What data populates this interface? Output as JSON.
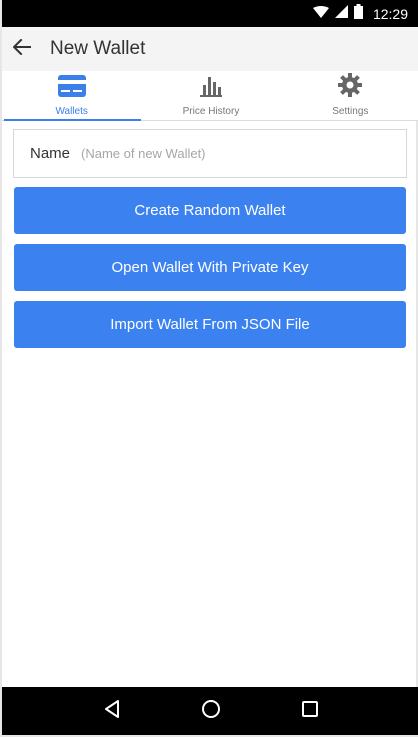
{
  "status_bar": {
    "time": "12:29",
    "icons": [
      "wifi-icon",
      "signal-icon",
      "battery-icon"
    ]
  },
  "app_bar": {
    "title": "New Wallet",
    "back_icon": "arrow-left-icon"
  },
  "tabs": [
    {
      "label": "Wallets",
      "icon": "credit-card-icon",
      "active": true
    },
    {
      "label": "Price History",
      "icon": "bar-chart-icon",
      "active": false
    },
    {
      "label": "Settings",
      "icon": "gear-icon",
      "active": false
    }
  ],
  "form": {
    "name_label": "Name",
    "name_placeholder": "(Name of new Wallet)",
    "name_value": ""
  },
  "buttons": {
    "create_random": "Create Random Wallet",
    "open_private_key": "Open Wallet With Private Key",
    "import_json": "Import Wallet From JSON File"
  },
  "nav_bar": {
    "icons": [
      "back-triangle-icon",
      "home-circle-icon",
      "recents-square-icon"
    ]
  },
  "colors": {
    "accent": "#3b82f0",
    "tab_active": "#3b7fe8",
    "status_bar": "#000000",
    "app_bar": "#f4f4f4"
  }
}
